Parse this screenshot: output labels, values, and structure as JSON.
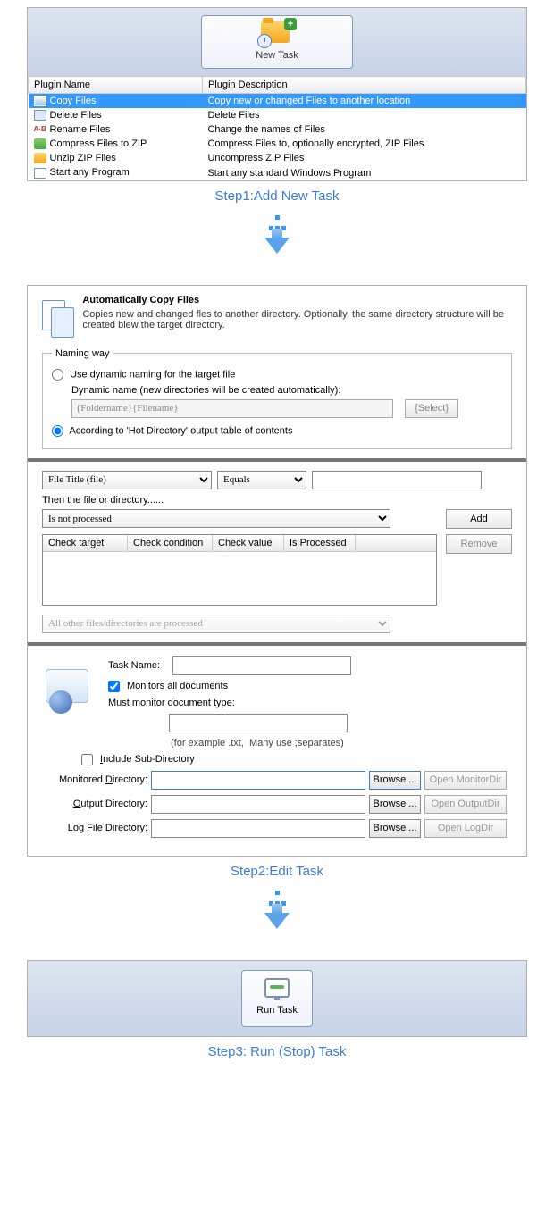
{
  "step1": {
    "new_task_label": "New Task",
    "columns": {
      "name": "Plugin Name",
      "desc": "Plugin Description"
    },
    "rows": [
      {
        "name": "Copy Files",
        "desc": "Copy new or changed Files to another location",
        "selected": true
      },
      {
        "name": "Delete Files",
        "desc": "Delete Files"
      },
      {
        "name": "Rename Files",
        "desc": "Change the names of Files"
      },
      {
        "name": "Compress Files to ZIP",
        "desc": "Compress Files to, optionally encrypted, ZIP Files"
      },
      {
        "name": "Unzip ZIP Files",
        "desc": "Uncompress ZIP Files"
      },
      {
        "name": "Start any Program",
        "desc": "Start any standard Windows Program"
      }
    ],
    "caption": "Step1:Add New Task"
  },
  "step2": {
    "title": "Automatically Copy Files",
    "desc": "Copies new and changed fles to another directory. Optionally, the same directory structure will be created blew the target directory.",
    "naming_legend": "Naming way",
    "radio_dynamic": "Use dynamic naming for the target file",
    "dynamic_label": "Dynamic name (new directories will be created automatically):",
    "dynamic_value": "{Foldername}{Filename}",
    "select_btn": "{Select}",
    "radio_hotdir": "According to 'Hot Directory' output table of contents",
    "filter_field": "File Title (file)",
    "filter_op": "Equals",
    "then_label": "Then the file or directory......",
    "then_combo": "Is not processed",
    "add_btn": "Add",
    "remove_btn": "Remove",
    "cols": {
      "target": "Check target",
      "cond": "Check condition",
      "val": "Check value",
      "proc": "Is Processed"
    },
    "all_other": "All other files/directories are processed",
    "task_name_label": "Task Name:",
    "monitors_all": "Monitors all documents",
    "must_monitor": "Must monitor document type:",
    "example_hint": "(for example .txt,  Many use ;separates)",
    "include_sub": "Include Sub-Directory",
    "mon_dir": "Monitored Directory:",
    "out_dir": "Output Directory:",
    "log_dir": "Log File Directory:",
    "browse": "Browse ...",
    "open_mon": "Open MonitorDir",
    "open_out": "Open OutputDir",
    "open_log": "Open LogDir",
    "caption": "Step2:Edit Task"
  },
  "step3": {
    "run_label": "Run Task",
    "caption": "Step3: Run (Stop) Task"
  }
}
